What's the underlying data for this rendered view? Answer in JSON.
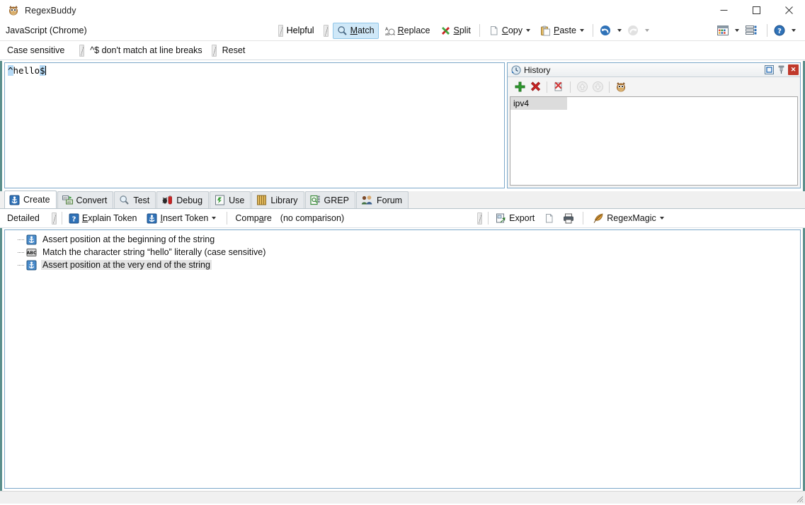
{
  "window": {
    "title": "RegexBuddy",
    "app_icon": "regexbuddy-owl-icon",
    "minimize_label": "Minimize",
    "maximize_label": "Maximize",
    "close_label": "Close"
  },
  "toolbar": {
    "flavor": "JavaScript (Chrome)",
    "helpful_label": "Helpful",
    "buttons": [
      {
        "name": "match",
        "label": "Match",
        "icon": "magnifier-icon",
        "active": true,
        "accel": "M"
      },
      {
        "name": "replace",
        "label": "Replace",
        "icon": "replace-ab-icon",
        "active": false,
        "accel": "R"
      },
      {
        "name": "split",
        "label": "Split",
        "icon": "split-icon",
        "active": false,
        "accel": "S"
      },
      {
        "name": "copy",
        "label": "Copy",
        "icon": "copy-page-icon",
        "active": false,
        "accel": "C",
        "dropdown": true
      },
      {
        "name": "paste",
        "label": "Paste",
        "icon": "paste-clipboard-icon",
        "active": false,
        "accel": "P",
        "dropdown": true
      }
    ],
    "undo_label": "Undo",
    "redo_label": "Redo",
    "grid_label": "Layout",
    "list_label": "Panels",
    "help_label": "Help"
  },
  "options": {
    "case_sensitive": "Case sensitive",
    "line_breaks": "^$ don't match at line breaks",
    "reset": "Reset"
  },
  "regex": {
    "full": "^hello$",
    "start_anchor": "^",
    "literal": "hello",
    "end_anchor": "$"
  },
  "history": {
    "title": "History",
    "panel_icon": "history-clock-icon",
    "header_buttons": [
      {
        "name": "restore",
        "icon": "restore-icon",
        "glyph": "▣"
      },
      {
        "name": "pin",
        "icon": "pin-icon",
        "glyph": "⚐"
      },
      {
        "name": "close",
        "icon": "close-icon",
        "glyph": "✕"
      }
    ],
    "toolbar_buttons": [
      {
        "name": "add",
        "icon": "plus-icon",
        "label": "Add"
      },
      {
        "name": "delete",
        "icon": "delete-x-icon",
        "label": "Delete"
      },
      {
        "name": "clear",
        "icon": "clear-all-icon",
        "label": "Clear All"
      },
      {
        "name": "move-up",
        "icon": "arrow-up-circle-icon",
        "label": "Move Up",
        "disabled": true
      },
      {
        "name": "move-down",
        "icon": "arrow-down-circle-icon",
        "label": "Move Down",
        "disabled": true
      },
      {
        "name": "library",
        "icon": "owl-icon",
        "label": "Library"
      }
    ],
    "items": [
      {
        "label": "ipv4",
        "selected": true
      }
    ]
  },
  "tabs": [
    {
      "name": "create",
      "label": "Create",
      "icon": "create-anchor-icon",
      "selected": true
    },
    {
      "name": "convert",
      "label": "Convert",
      "icon": "convert-icon",
      "selected": false
    },
    {
      "name": "test",
      "label": "Test",
      "icon": "magnifier-icon",
      "selected": false
    },
    {
      "name": "debug",
      "label": "Debug",
      "icon": "bug-icon",
      "selected": false
    },
    {
      "name": "use",
      "label": "Use",
      "icon": "use-export-icon",
      "selected": false
    },
    {
      "name": "library",
      "label": "Library",
      "icon": "library-books-icon",
      "selected": false
    },
    {
      "name": "grep",
      "label": "GREP",
      "icon": "grep-icon",
      "selected": false
    },
    {
      "name": "forum",
      "label": "Forum",
      "icon": "forum-people-icon",
      "selected": false
    }
  ],
  "subtoolbar": {
    "detail_level": "Detailed",
    "explain_token": "Explain Token",
    "explain_accel": "E",
    "insert_token": "Insert Token",
    "insert_accel": "I",
    "compare_label": "Compare",
    "compare_value": "(no comparison)",
    "export_label": "Export",
    "copy_label": "Copy",
    "print_label": "Print",
    "regexmagic_label": "RegexMagic"
  },
  "explanation": {
    "rows": [
      {
        "icon": "anchor-icon",
        "text": "Assert position at the beginning of the string",
        "selected": false
      },
      {
        "icon": "abc-literal-icon",
        "text": "Match the character string “hello” literally (case sensitive)",
        "selected": false
      },
      {
        "icon": "anchor-icon",
        "text": "Assert position at the very end of the string",
        "selected": true
      }
    ]
  },
  "colors": {
    "accent_blue": "#2f72b8",
    "panel_border": "#7ca8c9",
    "active_button": "#cfe8f8",
    "anchor_highlight": "#b5d9f5",
    "selection_gray": "#e4e4e4",
    "frame_teal": "#5b8f8c",
    "close_red": "#c0392b"
  }
}
